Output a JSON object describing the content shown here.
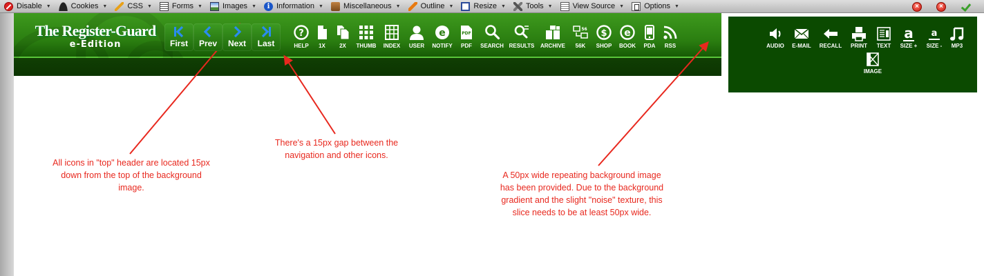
{
  "devbar": {
    "items": [
      {
        "label": "Disable",
        "icon": "disable-icon"
      },
      {
        "label": "Cookies",
        "icon": "cookies-icon"
      },
      {
        "label": "CSS",
        "icon": "css-icon"
      },
      {
        "label": "Forms",
        "icon": "forms-icon"
      },
      {
        "label": "Images",
        "icon": "images-icon"
      },
      {
        "label": "Information",
        "icon": "information-icon"
      },
      {
        "label": "Miscellaneous",
        "icon": "miscellaneous-icon"
      },
      {
        "label": "Outline",
        "icon": "outline-icon"
      },
      {
        "label": "Resize",
        "icon": "resize-icon"
      },
      {
        "label": "Tools",
        "icon": "tools-icon"
      },
      {
        "label": "View Source",
        "icon": "view-source-icon"
      },
      {
        "label": "Options",
        "icon": "options-icon"
      }
    ],
    "close_glyph": "×"
  },
  "logo": {
    "title": "The Register-Guard",
    "subtitle": "e-Edition"
  },
  "nav": {
    "first": "First",
    "prev": "Prev",
    "next": "Next",
    "last": "Last"
  },
  "toolbar": {
    "items": [
      "HELP",
      "1X",
      "2X",
      "THUMB",
      "INDEX",
      "USER",
      "NOTIFY",
      "PDF",
      "SEARCH",
      "RESULTS",
      "ARCHIVE",
      "56K",
      "SHOP",
      "BOOK",
      "PDA",
      "RSS"
    ],
    "pdf_glyph_text": "PDF",
    "k56_glyph_text": "56",
    "shop_glyph": "$",
    "book_glyph": "e"
  },
  "panel": {
    "items": [
      "AUDIO",
      "E-MAIL",
      "RECALL",
      "PRINT",
      "TEXT",
      "SIZE +",
      "SIZE -",
      "MP3",
      "IMAGE"
    ],
    "size_glyph": "a"
  },
  "annotations": {
    "note1": "All icons in \"top\" header are located 15px down from the top of the background image.",
    "note2": "There's a 15px gap between the navigation and other icons.",
    "note3": "A 50px wide repeating background image has been provided. Due to the background gradient and the slight \"noise\" texture, this slice needs to be at least 50px wide."
  },
  "colors": {
    "banner_green": "#2a7d10",
    "panel_green": "#0b4a00",
    "nav_arrow_blue": "#2a8cf0",
    "annotation_red": "#e8281e"
  }
}
